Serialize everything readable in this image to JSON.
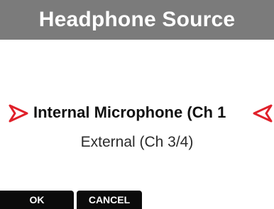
{
  "header": {
    "title": "Headphone Source"
  },
  "options": {
    "selected_label": "Internal Microphone (Ch 1",
    "other_label": "External (Ch 3/4)",
    "selected_index": 0
  },
  "softkeys": {
    "ok_label": "OK",
    "cancel_label": "CANCEL"
  },
  "colors": {
    "title_bar": "#7b7b7b",
    "selection_arrow": "#e0202a",
    "softkey_bg": "#0b0b0b"
  },
  "icons": {
    "left_arrow": "selection-arrow-right-pointing",
    "right_arrow": "selection-arrow-left-pointing"
  }
}
